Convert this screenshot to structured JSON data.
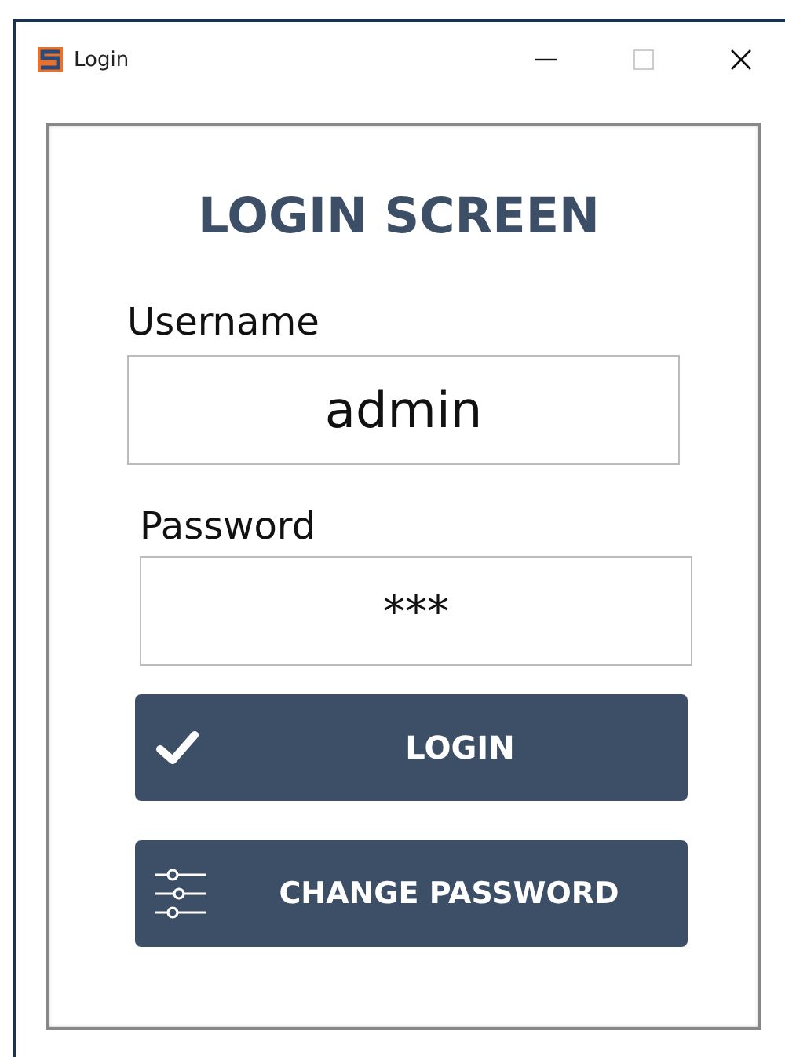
{
  "window": {
    "title": "Login"
  },
  "heading": "LOGIN SCREEN",
  "fields": [
    {
      "label": "Username",
      "value": "admin"
    },
    {
      "label": "Password",
      "value": "***"
    }
  ],
  "buttons": [
    {
      "kind": "check",
      "label": "LOGIN"
    },
    {
      "kind": "sliders",
      "label": "CHANGE PASSWORD"
    }
  ]
}
